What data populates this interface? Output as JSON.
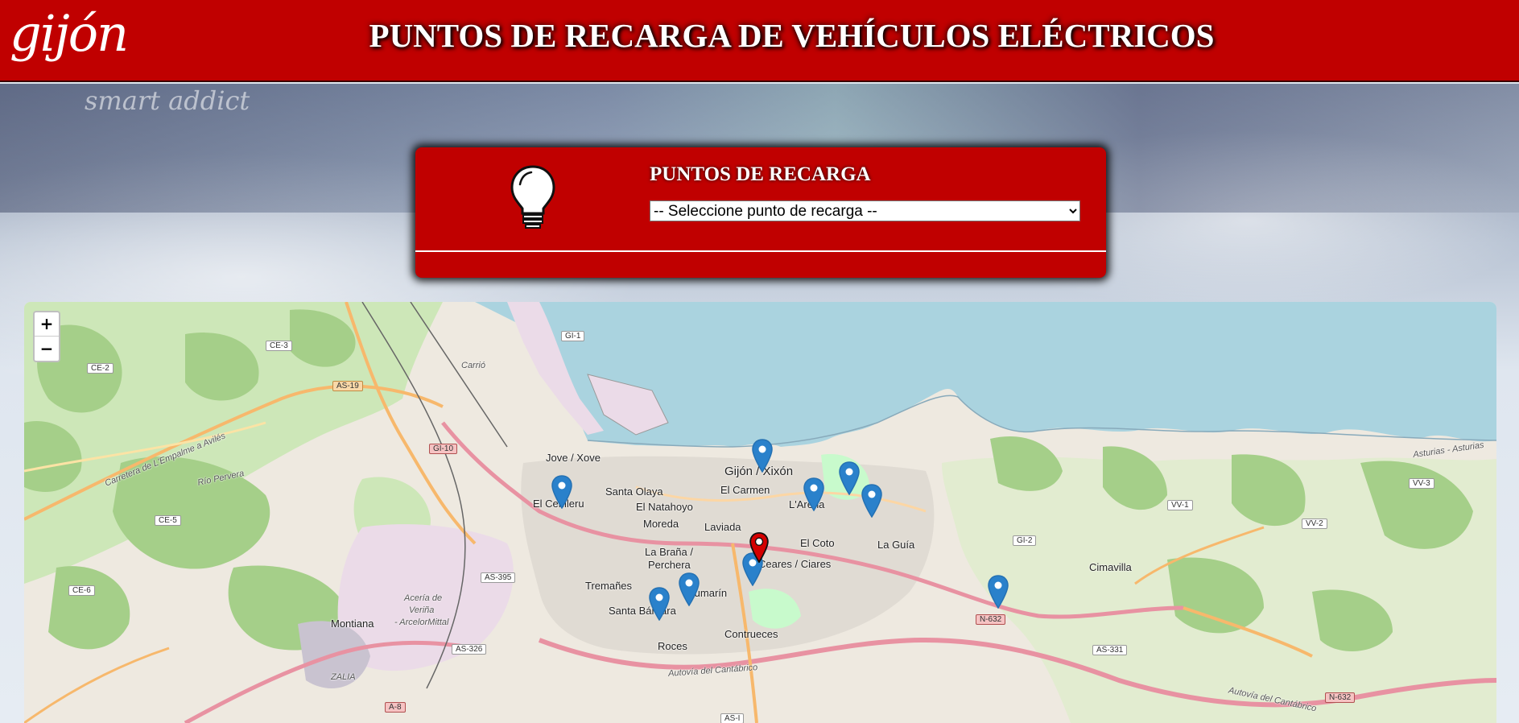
{
  "header": {
    "logo": "gijón",
    "title": "PUNTOS DE RECARGA DE VEHÍCULOS ELÉCTRICOS"
  },
  "background": {
    "car_text": "smart addict"
  },
  "panel": {
    "icon": "lightbulb-icon",
    "title": "PUNTOS DE RECARGA",
    "select": {
      "selected": "-- Seleccione punto de recarga --",
      "options": [
        "-- Seleccione punto de recarga --"
      ]
    }
  },
  "map": {
    "zoom_in": "+",
    "zoom_out": "−",
    "places": {
      "gijon": "Gijón / Xixón",
      "jove": "Jove / Xove",
      "el_cerillero": "El Cerilleru",
      "santa_olaya": "Santa Olaya",
      "el_natahoyo": "El Natahoyo",
      "el_carmen": "El Carmen",
      "larena": "L'Arena",
      "moreda": "Moreda",
      "laviada": "Laviada",
      "el_coto": "El Coto",
      "la_guia": "La Guía",
      "la_brana": "La Braña /",
      "perchera": "Perchera",
      "ceares": "Ceares / Ciares",
      "tremanes": "Tremañes",
      "pumarin": "Pumarín",
      "santa_barbara": "Santa Bárbara",
      "contrueces": "Contrueces",
      "roces": "Roces",
      "montiana": "Montiana",
      "carrio": "Carrió",
      "cimavilla": "Cimavilla",
      "aceria": "Acería de",
      "verina": "Veriña",
      "arcelor": "- ArcelorMittal",
      "zalia": "ZALIA",
      "carretera": "Carretera de L'Empalme a Avilés",
      "rio_pervera": "Río Pervera",
      "autovia": "Autovía del Cantábrico",
      "autovia2": "Autovía del Cantábrico",
      "asturias": "Asturias - Asturias"
    },
    "roads": {
      "gi1": "GI-1",
      "ce3": "CE-3",
      "ce2": "CE-2",
      "as19": "AS-19",
      "gi10": "GI-10",
      "ce5": "CE-5",
      "ce6": "CE-6",
      "as395": "AS-395",
      "as326": "AS-326",
      "a8": "A-8",
      "asi": "AS-I",
      "gi2": "GI-2",
      "vv1": "VV-1",
      "vv2": "VV-2",
      "vv3": "VV-3",
      "n632a": "N-632",
      "as331": "AS-331",
      "n632b": "N-632"
    },
    "markers": [
      {
        "color": "blue"
      },
      {
        "color": "blue"
      },
      {
        "color": "blue"
      },
      {
        "color": "blue"
      },
      {
        "color": "blue"
      },
      {
        "color": "blue"
      },
      {
        "color": "blue"
      },
      {
        "color": "blue"
      },
      {
        "color": "blue"
      },
      {
        "color": "red"
      }
    ]
  }
}
